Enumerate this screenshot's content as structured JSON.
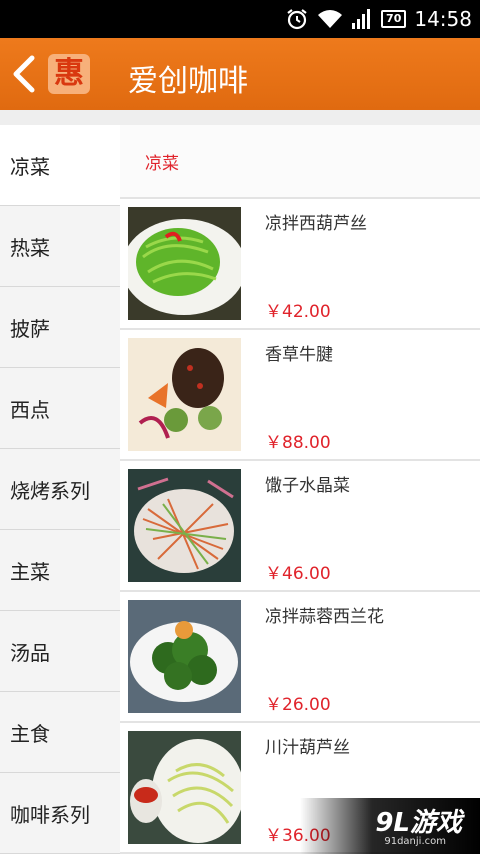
{
  "status_bar": {
    "battery": "70",
    "time": "14:58",
    "icons": [
      "alarm-icon",
      "wifi-icon",
      "signal-icon",
      "battery-icon"
    ]
  },
  "app_bar": {
    "logo_char": "惠",
    "title": "爱创咖啡"
  },
  "sidebar": {
    "items": [
      {
        "label": "凉菜",
        "active": true
      },
      {
        "label": "热菜"
      },
      {
        "label": "披萨"
      },
      {
        "label": "西点"
      },
      {
        "label": "烧烤系列"
      },
      {
        "label": "主菜"
      },
      {
        "label": "汤品"
      },
      {
        "label": "主食"
      },
      {
        "label": "咖啡系列"
      }
    ]
  },
  "content": {
    "category": "凉菜",
    "dishes": [
      {
        "name": "凉拌西葫芦丝",
        "price": "￥42.00"
      },
      {
        "name": "香草牛腱",
        "price": "￥88.00"
      },
      {
        "name": "馓子水晶菜",
        "price": "￥46.00"
      },
      {
        "name": "凉拌蒜蓉西兰花",
        "price": "￥26.00"
      },
      {
        "name": "川汁葫芦丝",
        "price": "￥36.00"
      }
    ]
  },
  "watermark": {
    "brand": "9L游戏",
    "domain": "91danji.com"
  },
  "colors": {
    "accent": "#e8731a",
    "price": "#e0232b"
  }
}
